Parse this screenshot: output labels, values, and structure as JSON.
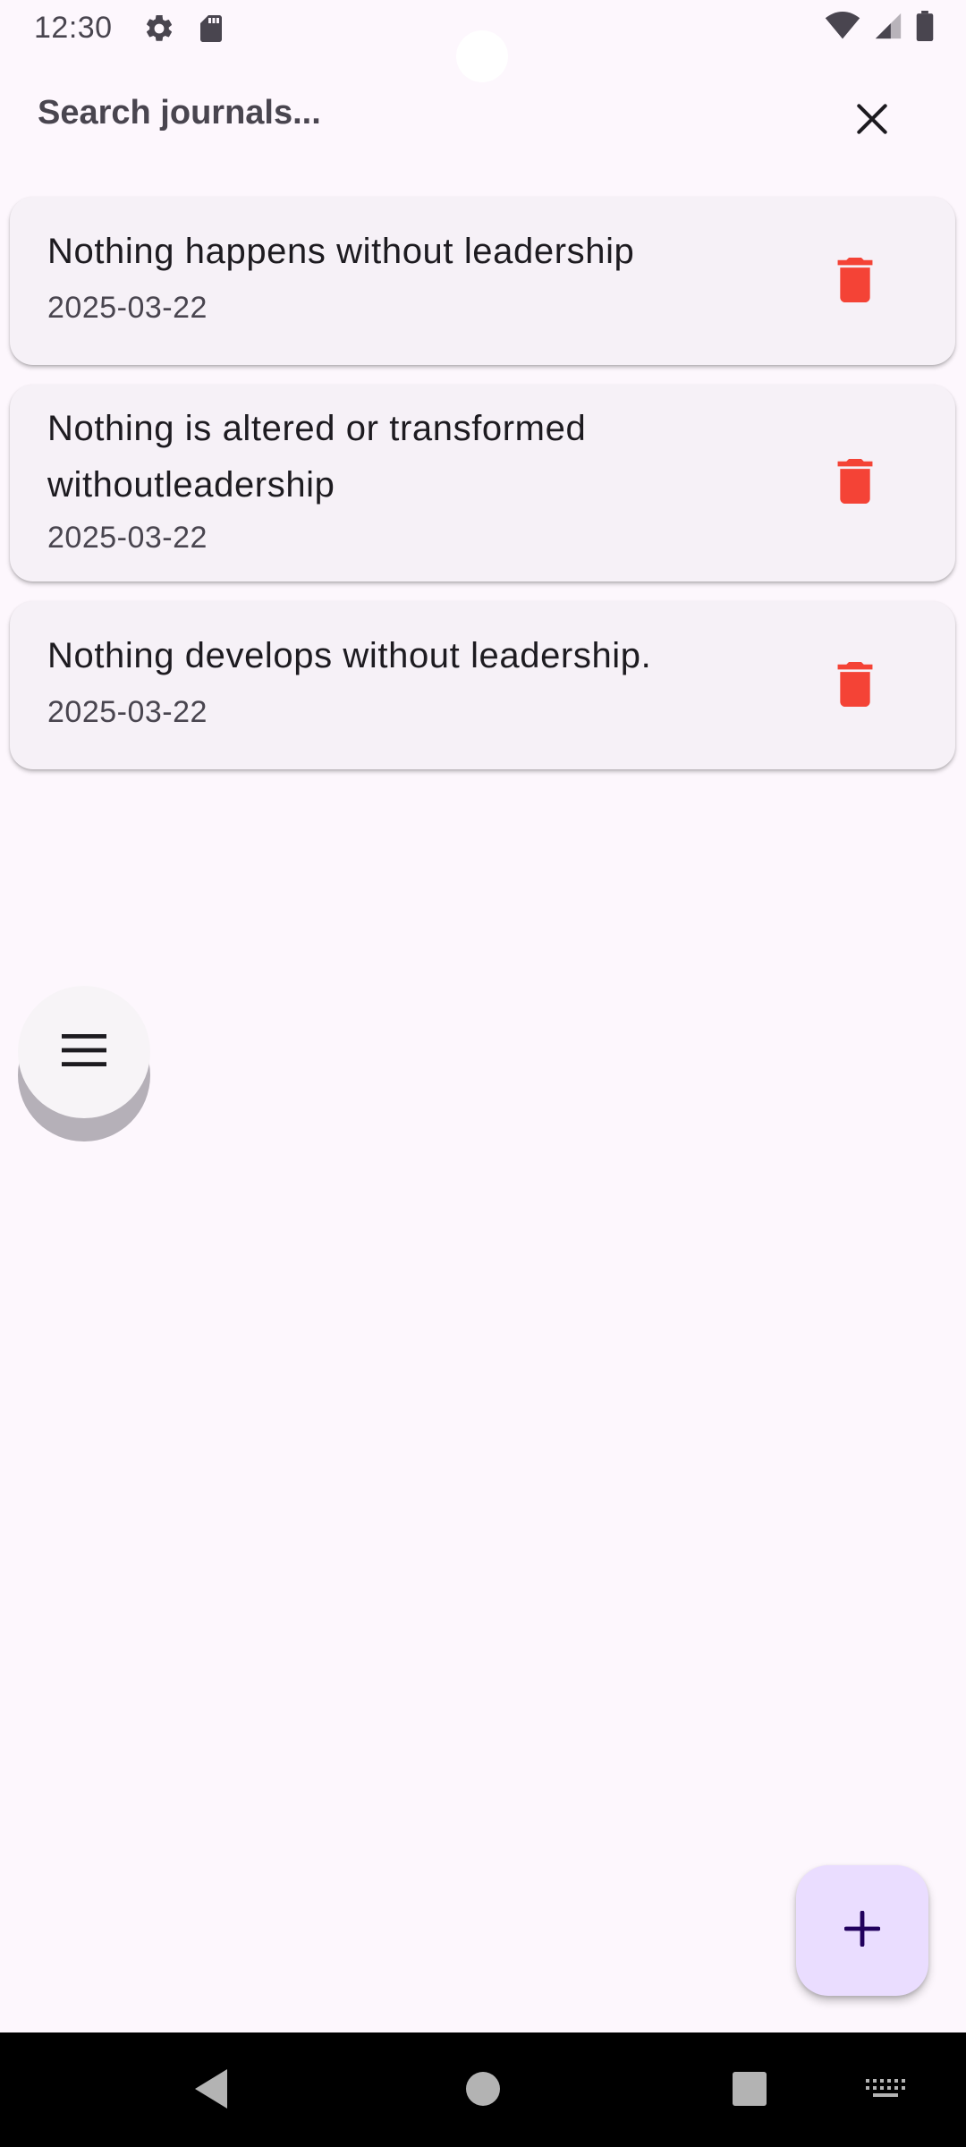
{
  "status_bar": {
    "time": "12:30"
  },
  "search": {
    "placeholder": "Search journals..."
  },
  "journals": [
    {
      "title": "Nothing happens without leadership",
      "date": "2025-03-22"
    },
    {
      "title": "Nothing is altered or transformed withoutleadership",
      "date": "2025-03-22"
    },
    {
      "title": "Nothing develops without leadership.",
      "date": "2025-03-22"
    }
  ],
  "icons": {
    "close": "close-icon",
    "delete": "trash-icon",
    "menu": "menu-icon",
    "add": "plus-icon"
  },
  "colors": {
    "background": "#fdf7fd",
    "card": "#f6f1f7",
    "delete_red": "#f44336",
    "fab": "#eaddff",
    "fab_icon": "#21005d"
  }
}
